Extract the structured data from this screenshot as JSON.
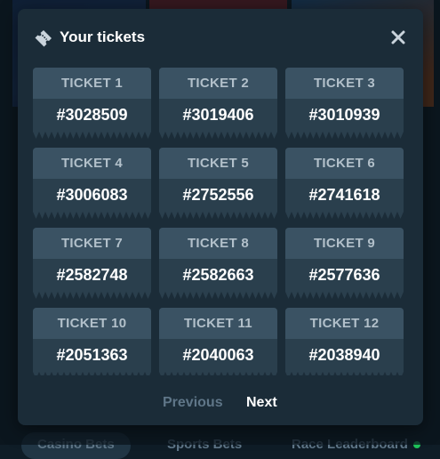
{
  "modal": {
    "title": "Your tickets",
    "icon": "ticket-icon",
    "close_icon": "close-icon"
  },
  "tickets": [
    {
      "label": "TICKET 1",
      "number": "#3028509"
    },
    {
      "label": "TICKET 2",
      "number": "#3019406"
    },
    {
      "label": "TICKET 3",
      "number": "#3010939"
    },
    {
      "label": "TICKET 4",
      "number": "#3006083"
    },
    {
      "label": "TICKET 5",
      "number": "#2752556"
    },
    {
      "label": "TICKET 6",
      "number": "#2741618"
    },
    {
      "label": "TICKET 7",
      "number": "#2582748"
    },
    {
      "label": "TICKET 8",
      "number": "#2582663"
    },
    {
      "label": "TICKET 9",
      "number": "#2577636"
    },
    {
      "label": "TICKET 10",
      "number": "#2051363"
    },
    {
      "label": "TICKET 11",
      "number": "#2040063"
    },
    {
      "label": "TICKET 12",
      "number": "#2038940"
    }
  ],
  "pagination": {
    "previous_label": "Previous",
    "next_label": "Next"
  },
  "background_tabs": [
    {
      "label": "Casino Bets",
      "active": true
    },
    {
      "label": "Sports Bets",
      "active": false
    },
    {
      "label": "Race Leaderboard",
      "active": false,
      "live": true
    }
  ],
  "colors": {
    "modal_bg": "#1b2c38",
    "ticket_header": "#3a5263",
    "ticket_body": "#2a3f4d",
    "live_dot": "#1fc45a"
  }
}
